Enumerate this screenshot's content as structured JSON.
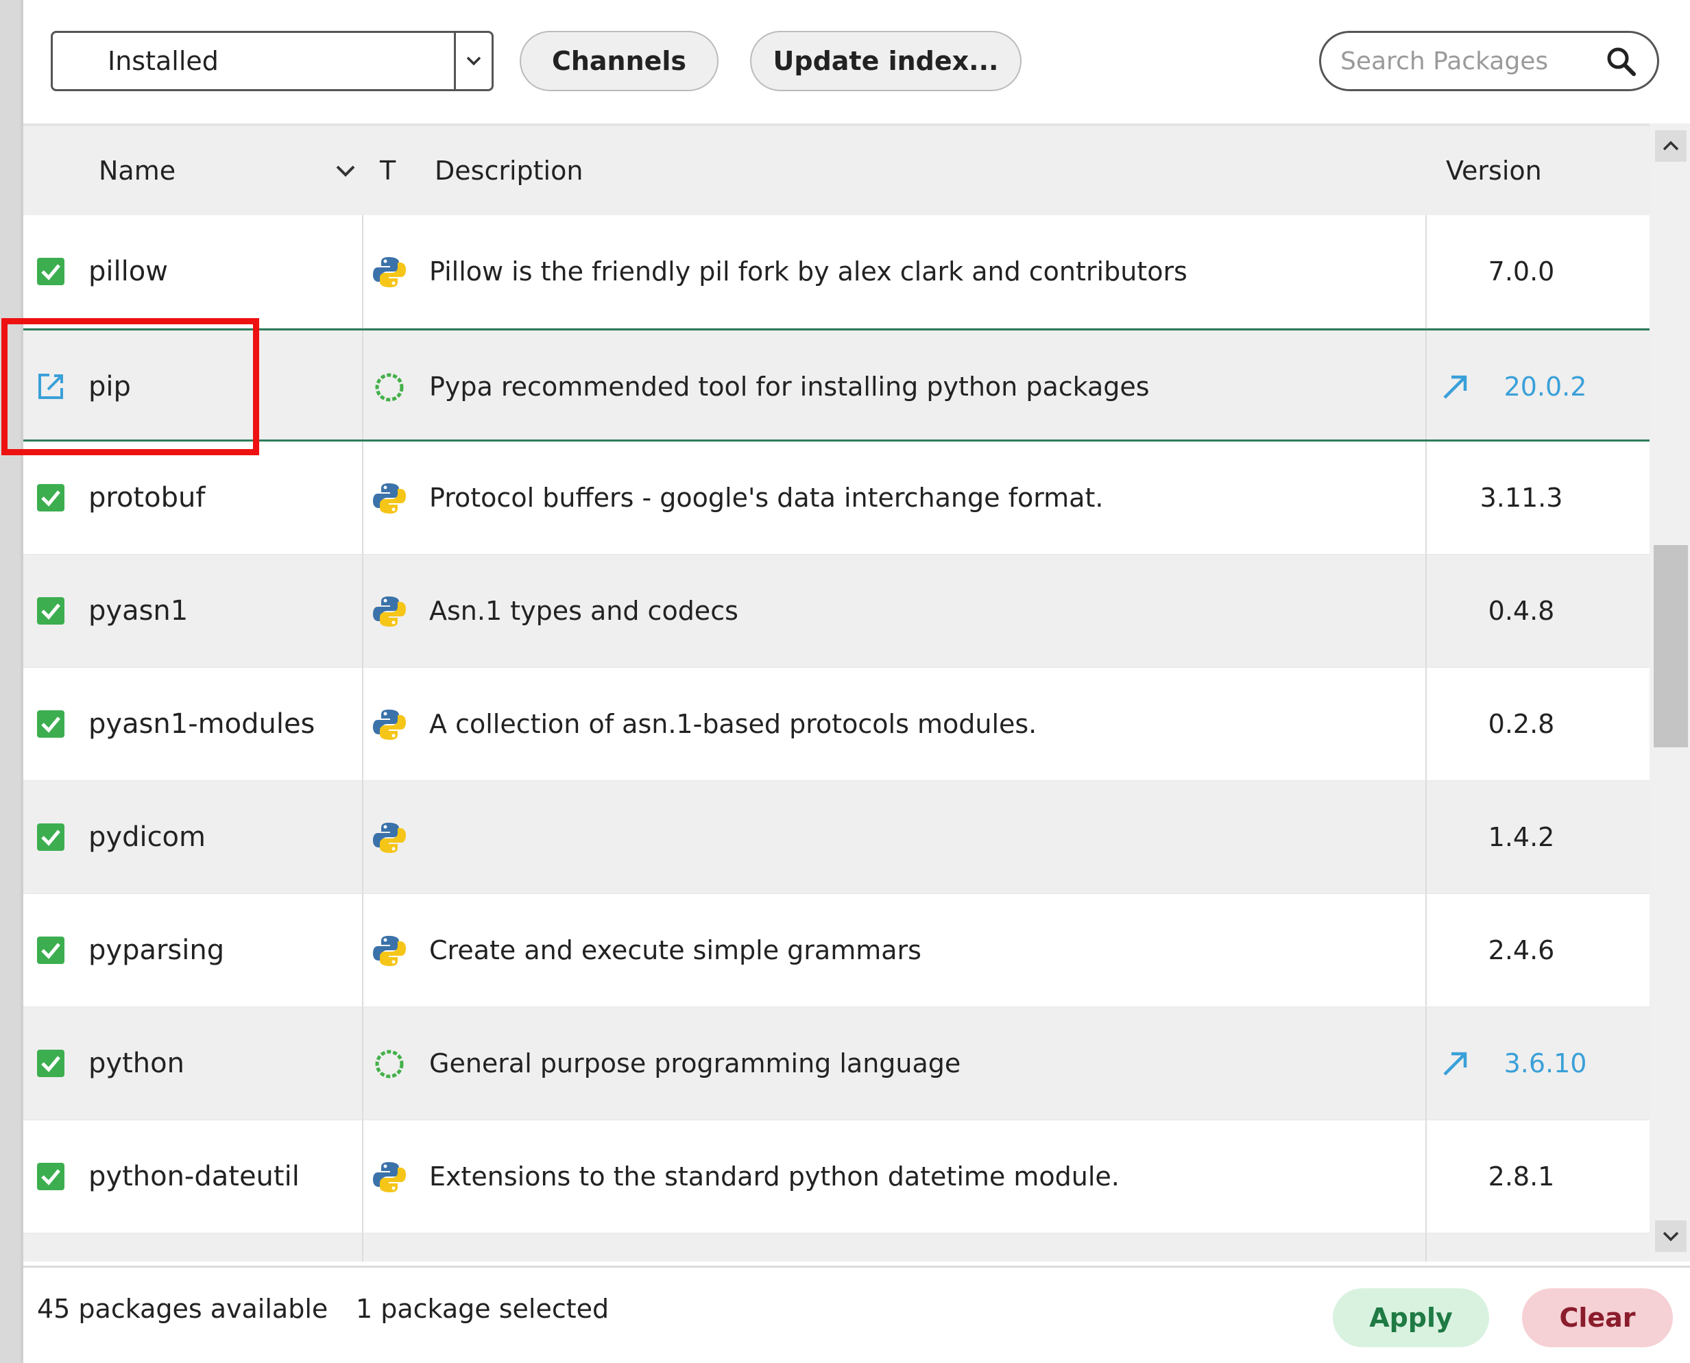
{
  "toolbar": {
    "filter_value": "Installed",
    "channels_label": "Channels",
    "update_label": "Update index...",
    "search_placeholder": "Search Packages"
  },
  "table": {
    "headers": {
      "name": "Name",
      "type": "T",
      "description": "Description",
      "version": "Version"
    },
    "rows": [
      {
        "name": "pillow",
        "description": "Pillow is the friendly pil fork by alex clark and contributors",
        "version": "7.0.0",
        "status": "installed",
        "type_icon": "python-icon",
        "upgrade": false
      },
      {
        "name": "pip",
        "description": "Pypa recommended tool for installing python packages",
        "version": "20.0.2",
        "status": "mark-for-update",
        "type_icon": "conda-icon",
        "upgrade": true
      },
      {
        "name": "protobuf",
        "description": "Protocol buffers - google's data interchange format.",
        "version": "3.11.3",
        "status": "installed",
        "type_icon": "python-icon",
        "upgrade": false
      },
      {
        "name": "pyasn1",
        "description": "Asn.1 types and codecs",
        "version": "0.4.8",
        "status": "installed",
        "type_icon": "python-icon",
        "upgrade": false
      },
      {
        "name": "pyasn1-modules",
        "description": "A collection of asn.1-based protocols modules.",
        "version": "0.2.8",
        "status": "installed",
        "type_icon": "python-icon",
        "upgrade": false
      },
      {
        "name": "pydicom",
        "description": "",
        "version": "1.4.2",
        "status": "installed",
        "type_icon": "python-icon",
        "upgrade": false
      },
      {
        "name": "pyparsing",
        "description": "Create and execute simple grammars",
        "version": "2.4.6",
        "status": "installed",
        "type_icon": "python-icon",
        "upgrade": false
      },
      {
        "name": "python",
        "description": "General purpose programming language",
        "version": "3.6.10",
        "status": "installed",
        "type_icon": "conda-icon",
        "upgrade": true
      },
      {
        "name": "python-dateutil",
        "description": "Extensions to the standard python datetime module.",
        "version": "2.8.1",
        "status": "installed",
        "type_icon": "python-icon",
        "upgrade": false
      }
    ]
  },
  "footer": {
    "available": "45 packages available",
    "selected": "1 package selected",
    "apply_label": "Apply",
    "clear_label": "Clear"
  },
  "colors": {
    "check_green": "#3cae4f",
    "update_blue": "#3aa0d8",
    "selected_border": "#2d7d5a",
    "highlight_red": "#ee1111",
    "apply_bg": "#d9f2e0",
    "clear_bg": "#f5d0d4"
  }
}
